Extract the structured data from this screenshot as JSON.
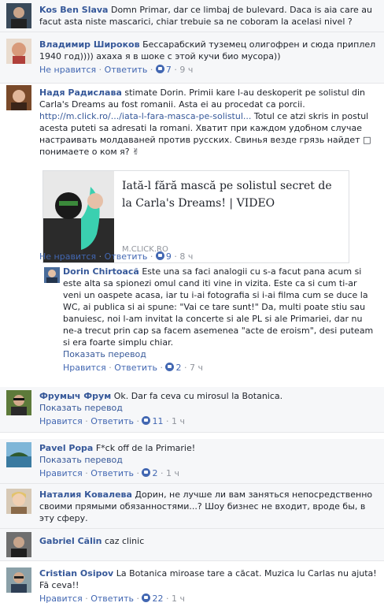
{
  "comments": [
    {
      "author": "Kos Ben Slava",
      "text": "Domn Primar, dar ce limbaj de bulevard. Daca is aia care au facut asta niste mascarici, chiar trebuie sa ne coboram la acelasi nivel ?"
    },
    {
      "author": "Владимир Широков",
      "text": "Бессарабский туземец олигофрен и сюда приплел 1940 год)))) ахаха я в шоке с этой кучи био мусора))",
      "actions": {
        "unlike": "Не нравится",
        "reply": "Ответить",
        "likes": "7",
        "time": "9 ч"
      }
    },
    {
      "author": "Надя Радислава",
      "text": "stimate Dorin. Primii kare l-au deskoperit pe solistul din Carla's Dreams au fost romanii. Asta ei au procedat ca porcii.",
      "link": "http://m.click.ro/.../iata-l-fara-masca-pe-solistul...",
      "text2": "Totul ce atzi skris in postul acesta puteti sa adresati la romani. Хватит при каждом удобном случае настраивать молдаваней против русских. Свинья везде грязь найдет",
      "text3": "понимаете о ком я?",
      "card": {
        "title": "Iată-l fără mască pe solistul secret de la Carla's Dreams! | VIDEO",
        "domain": "M.CLICK.RO"
      },
      "actions": {
        "unlike": "Не нравится",
        "reply": "Ответить",
        "likes": "9",
        "time": "8 ч"
      }
    },
    {
      "author": "Dorin Chirtoacă",
      "text": "Este una sa faci analogii cu s-a facut pana acum si este alta sa spionezi omul cand iti vine in vizita. Este ca si cum ti-ar veni un oaspete acasa, iar tu i-ai fotografia si i-ai filma cum se duce la WC, ai publica si ai spune: \"Vai ce tare sunt!\" Da, multi poate stiu sau banuiesc, noi l-am invitat la concerte si ale PL si ale Primariei, dar nu ne-a trecut prin cap sa facem asemenea \"acte de eroism\", desi puteam si era foarte simplu chiar.",
      "translate": "Показать перевод",
      "actions": {
        "unlike": "Нравится",
        "reply": "Ответить",
        "likes": "2",
        "time": "7 ч"
      }
    },
    {
      "author": "Фрумыч Фрум",
      "text": "Ok. Dar fa ceva cu mirosul la Botanica.",
      "translate": "Показать перевод",
      "actions": {
        "unlike": "Нравится",
        "reply": "Ответить",
        "likes": "11",
        "time": "1 ч"
      }
    },
    {
      "author": "Pavel Popa",
      "text": "F*ck off de la Primarie!",
      "translate": "Показать перевод",
      "actions": {
        "unlike": "Нравится",
        "reply": "Ответить",
        "likes": "2",
        "time": "1 ч"
      }
    },
    {
      "author": "Наталия Ковалева",
      "text": "Дорин, не лучше ли вам заняться непосредственно своими прямыми обязанностями...? Шоу бизнес не входит, вроде бы, в эту сферу."
    },
    {
      "author": "Gabriel Călin",
      "text": "caz clinic"
    },
    {
      "author": "Cristian Osipov",
      "text": "La Botanica miroase tare a căcat. Muzica lu Carlas nu ajuta! Fă ceva!!",
      "actions": {
        "unlike": "Нравится",
        "reply": "Ответить",
        "likes": "22",
        "time": "1 ч"
      }
    }
  ],
  "colors": {
    "link": "#365899",
    "meta": "#90949c",
    "like": "#4267b2"
  }
}
